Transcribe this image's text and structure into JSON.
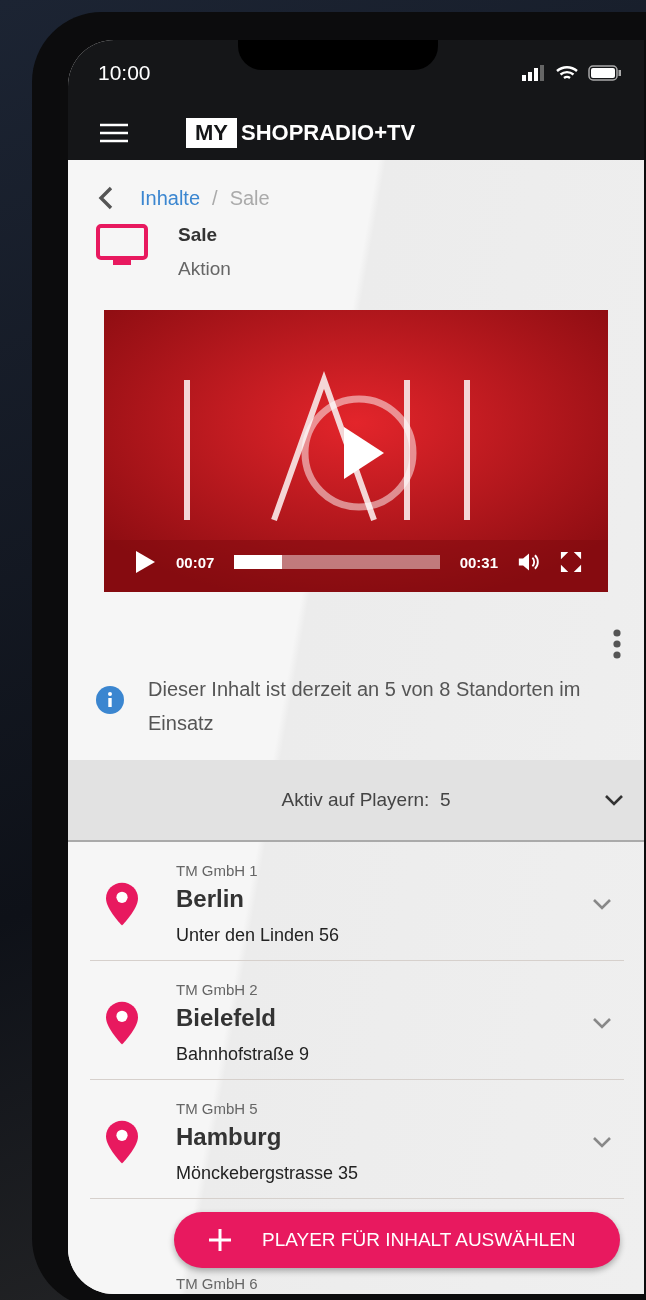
{
  "status_bar": {
    "time": "10:00"
  },
  "header": {
    "logo_box": "MY",
    "logo_text": "SHOPRADIO+TV"
  },
  "breadcrumb": {
    "items": [
      "Inhalte",
      "Sale"
    ],
    "separator": "/"
  },
  "content": {
    "title": "Sale",
    "subtitle": "Aktion"
  },
  "video": {
    "kind": "picture",
    "current": "00:07",
    "duration": "00:31",
    "level": 0.23
  },
  "info": "Dieser Inhalt ist derzeit an 5 von 8 Standorten im Einsatz",
  "accordion": {
    "label": "Aktiv auf Playern:",
    "count": "5"
  },
  "locations": [
    {
      "company": "TM GmbH 1",
      "city": "Berlin",
      "address": "Unter den Linden 56"
    },
    {
      "company": "TM GmbH 2",
      "city": "Bielefeld",
      "address": "Bahnhofstraße 9"
    },
    {
      "company": "TM GmbH 5",
      "city": "Hamburg",
      "address": "Mönckebergstrasse 35"
    },
    {
      "company": "TM GmbH 6"
    }
  ],
  "fab": {
    "label": "PLAYER FÜR INHALT AUSWÄHLEN"
  }
}
